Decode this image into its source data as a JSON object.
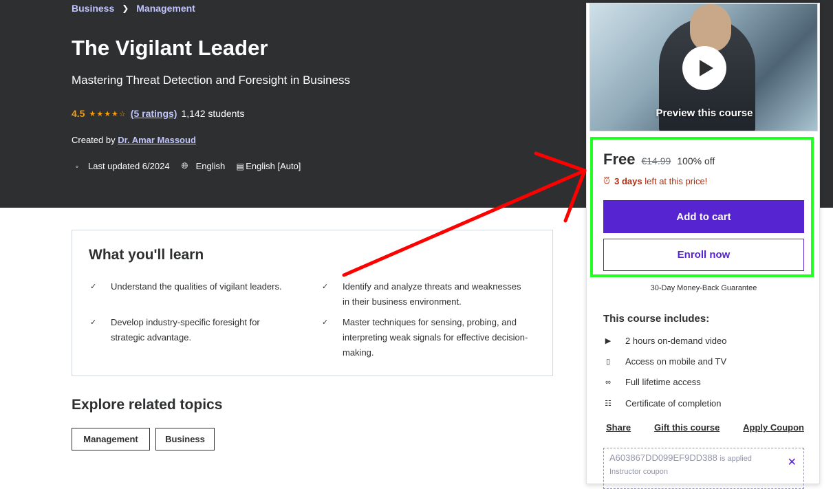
{
  "breadcrumb": {
    "items": [
      "Business",
      "Management"
    ]
  },
  "course": {
    "title": "The Vigilant Leader",
    "subtitle": "Mastering Threat Detection and Foresight in Business",
    "rating": "4.5",
    "ratings_count": "(5 ratings)",
    "students": "1,142 students",
    "created_prefix": "Created by",
    "instructor": "Dr. Amar Massoud",
    "last_updated": "Last updated 6/2024",
    "language": "English",
    "captions": "English [Auto]"
  },
  "learn": {
    "title": "What you'll learn",
    "items": [
      "Understand the qualities of vigilant leaders.",
      "Identify and analyze threats and weaknesses in their business environment.",
      "Develop industry-specific foresight for strategic advantage.",
      "Master techniques for sensing, probing, and interpreting weak signals for effective decision-making."
    ]
  },
  "explore": {
    "title": "Explore related topics",
    "topics": [
      "Management",
      "Business"
    ]
  },
  "sidebar": {
    "preview_label": "Preview this course",
    "price": "Free",
    "original_price": "€14.99",
    "discount": "100% off",
    "timer_bold": "3 days",
    "timer_rest": "left at this price!",
    "add_to_cart": "Add to cart",
    "enroll_now": "Enroll now",
    "guarantee": "30-Day Money-Back Guarantee",
    "includes_title": "This course includes:",
    "includes": [
      {
        "icon": "video-icon",
        "label": "2 hours on-demand video"
      },
      {
        "icon": "mobile-icon",
        "label": "Access on mobile and TV"
      },
      {
        "icon": "infinity-icon",
        "label": "Full lifetime access"
      },
      {
        "icon": "trophy-icon",
        "label": "Certificate of completion"
      }
    ],
    "links": [
      "Share",
      "Gift this course",
      "Apply Coupon"
    ],
    "coupon_code": "A603867DD099EF9DD388",
    "coupon_applied": "is applied",
    "coupon_sub": "Instructor coupon"
  },
  "colors": {
    "hero_bg": "#2d2f31",
    "accent_purple": "#5624d0",
    "link_lavender": "#c0c4fc",
    "star_orange": "#f69c08",
    "timer_red": "#b32d0f",
    "highlight_green": "#22ff22",
    "annotation_arrow": "#ff0000"
  }
}
